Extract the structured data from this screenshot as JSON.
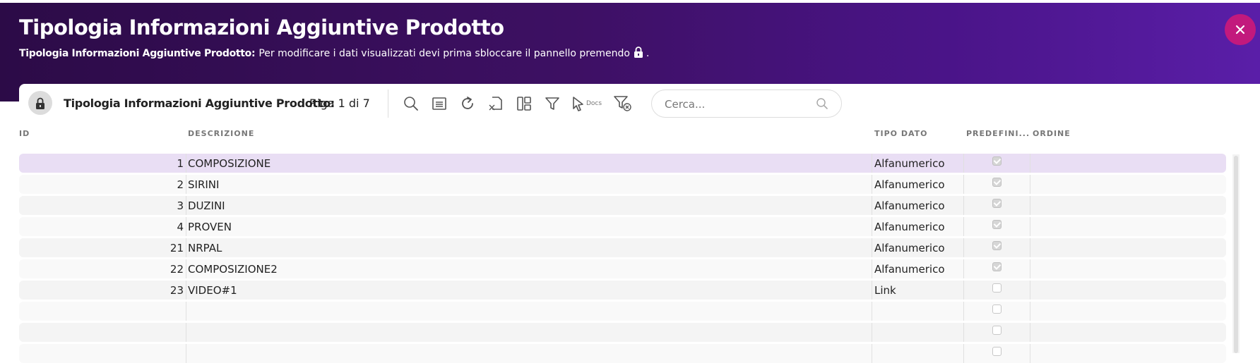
{
  "header": {
    "title": "Tipologia Informazioni Aggiuntive Prodotto",
    "subtitle_bold": "Tipologia Informazioni Aggiuntive Prodotto:",
    "subtitle_text": "Per modificare i dati visualizzati devi prima sbloccare il pannello premendo",
    "subtitle_end": ".",
    "close_icon": "close-icon",
    "background": "#3d1063",
    "close_color": "#c2197d"
  },
  "toolbar": {
    "title": "Tipologia Informazioni Aggiuntive Prodotto:",
    "record": "Riga 1 di 7",
    "docs_label": "Docs",
    "icons": [
      "lock-icon",
      "search-icon",
      "list-icon",
      "refresh-icon",
      "export-icon",
      "layout-icon",
      "filter-icon",
      "docs-icon",
      "clear-filter-icon"
    ]
  },
  "search": {
    "placeholder": "Cerca..."
  },
  "grid": {
    "columns": {
      "id": "ID",
      "descrizione": "DESCRIZIONE",
      "tipo": "TIPO DATO",
      "predefinito": "PREDEFINI...",
      "ordine": "ORDINE"
    },
    "rows": [
      {
        "id": "1",
        "descrizione": "COMPOSIZIONE",
        "tipo": "Alfanumerico",
        "predefinito": true,
        "selected": true
      },
      {
        "id": "2",
        "descrizione": "SIRINI",
        "tipo": "Alfanumerico",
        "predefinito": true
      },
      {
        "id": "3",
        "descrizione": "DUZINI",
        "tipo": "Alfanumerico",
        "predefinito": true
      },
      {
        "id": "4",
        "descrizione": "PROVEN",
        "tipo": "Alfanumerico",
        "predefinito": true
      },
      {
        "id": "21",
        "descrizione": "NRPAL",
        "tipo": "Alfanumerico",
        "predefinito": true
      },
      {
        "id": "22",
        "descrizione": "COMPOSIZIONE2",
        "tipo": "Alfanumerico",
        "predefinito": true
      },
      {
        "id": "23",
        "descrizione": "VIDEO#1",
        "tipo": "Link",
        "predefinito": false
      },
      {
        "id": "",
        "descrizione": "",
        "tipo": "",
        "predefinito": false
      },
      {
        "id": "",
        "descrizione": "",
        "tipo": "",
        "predefinito": false
      },
      {
        "id": "",
        "descrizione": "",
        "tipo": "",
        "predefinito": false
      }
    ]
  }
}
